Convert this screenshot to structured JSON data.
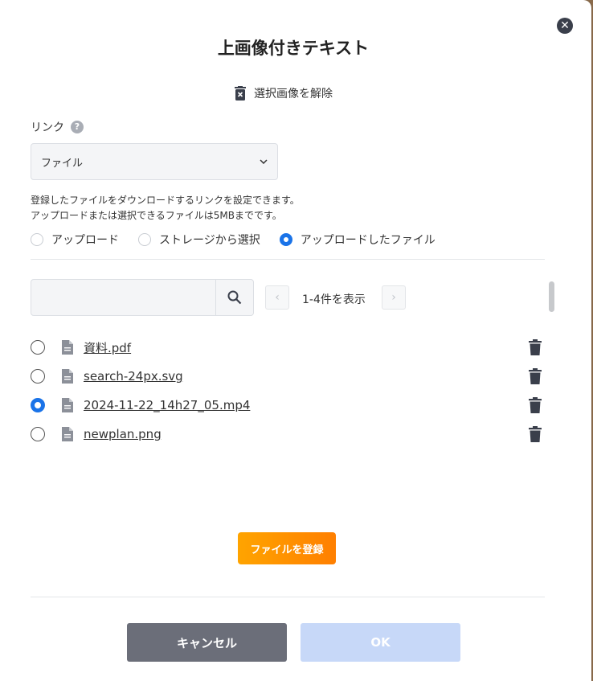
{
  "dialog": {
    "title": "上画像付きテキスト",
    "deselect_label": "選択画像を解除",
    "close_icon": "close-icon"
  },
  "link": {
    "label": "リンク",
    "help": "?",
    "select_value": "ファイル",
    "help_text_1": "登録したファイルをダウンロードするリンクを設定できます。",
    "help_text_2": "アップロードまたは選択できるファイルは5MBまでです。"
  },
  "source_options": [
    {
      "label": "アップロード",
      "selected": false
    },
    {
      "label": "ストレージから選択",
      "selected": false
    },
    {
      "label": "アップロードしたファイル",
      "selected": true
    }
  ],
  "file_list": {
    "search_value": "",
    "pager_text": "1-4件を表示",
    "prev_label": "‹",
    "next_label": "›",
    "files": [
      {
        "name": "資料.pdf",
        "selected": false
      },
      {
        "name": "search-24px.svg",
        "selected": false
      },
      {
        "name": "2024-11-22_14h27_05.mp4",
        "selected": true
      },
      {
        "name": "newplan.png",
        "selected": false
      }
    ]
  },
  "actions": {
    "register_label": "ファイルを登録",
    "cancel_label": "キャンセル",
    "ok_label": "OK"
  },
  "colors": {
    "accent": "#1a73e8",
    "register_gradient_start": "#ffa400",
    "register_gradient_end": "#ff7f00",
    "cancel_bg": "#6b6e79",
    "ok_disabled_bg": "#c7d8f8"
  }
}
